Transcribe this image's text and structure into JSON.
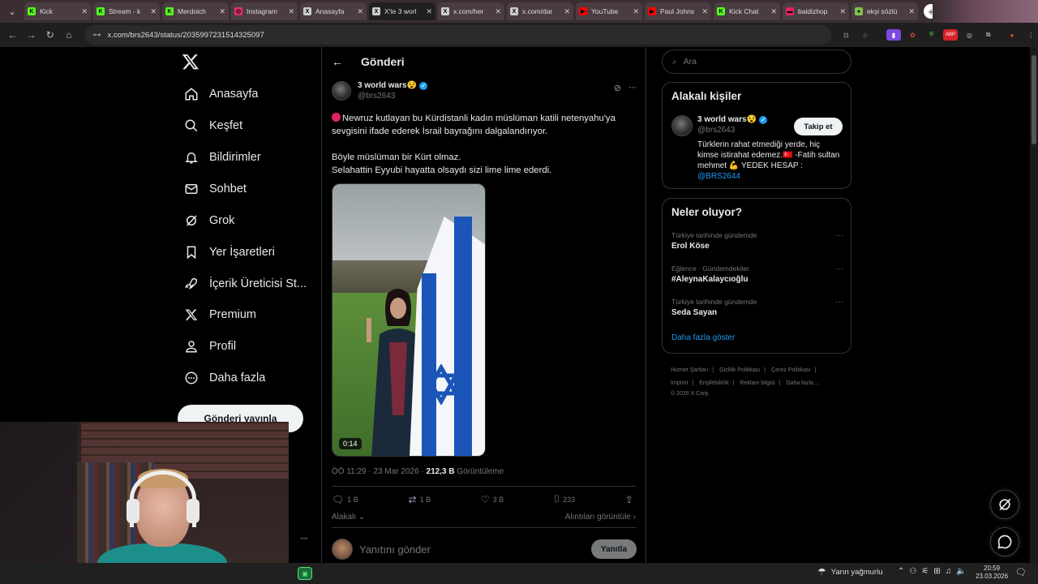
{
  "browser": {
    "tabs": [
      {
        "title": "Kick",
        "favicon_color": "#53fc18",
        "favicon": "K"
      },
      {
        "title": "Stream - k",
        "favicon_color": "#53fc18",
        "favicon": "K"
      },
      {
        "title": "Merdoich",
        "favicon_color": "#53fc18",
        "favicon": "K"
      },
      {
        "title": "Instagram",
        "favicon_color": "#e1306c",
        "favicon": "◎"
      },
      {
        "title": "Anasayfa",
        "favicon_color": "#cccccc",
        "favicon": "X"
      },
      {
        "title": "X'te 3 worl",
        "favicon_color": "#cccccc",
        "favicon": "X"
      },
      {
        "title": "x.com/her",
        "favicon_color": "#cccccc",
        "favicon": "X"
      },
      {
        "title": "x.com/dar",
        "favicon_color": "#cccccc",
        "favicon": "X"
      },
      {
        "title": "YouTube",
        "favicon_color": "#ff0000",
        "favicon": "▶"
      },
      {
        "title": "Paul Johns",
        "favicon_color": "#ff0000",
        "favicon": "▶"
      },
      {
        "title": "Kick Chat",
        "favicon_color": "#53fc18",
        "favicon": "K"
      },
      {
        "title": "baldizhop",
        "favicon_color": "#e0245e",
        "favicon": "▬"
      },
      {
        "title": "ekşi sözlü",
        "favicon_color": "#81c14b",
        "favicon": "●"
      }
    ],
    "url": "x.com/brs2643/status/2035997231514325097"
  },
  "nav": {
    "items": [
      {
        "label": "Anasayfa",
        "icon": "home-icon"
      },
      {
        "label": "Keşfet",
        "icon": "search-icon"
      },
      {
        "label": "Bildirimler",
        "icon": "bell-icon"
      },
      {
        "label": "Sohbet",
        "icon": "mail-icon"
      },
      {
        "label": "Grok",
        "icon": "grok-icon"
      },
      {
        "label": "Yer İşaretleri",
        "icon": "bookmark-icon"
      },
      {
        "label": "İçerik Üreticisi St...",
        "icon": "rocket-icon"
      },
      {
        "label": "Premium",
        "icon": "x-icon"
      },
      {
        "label": "Profil",
        "icon": "person-icon"
      },
      {
        "label": "Daha fazla",
        "icon": "more-circle-icon"
      }
    ],
    "post_button": "Gönderi yayınla"
  },
  "post": {
    "header_title": "Gönderi",
    "author_name": "3 world wars😵",
    "author_handle": "@brs2643",
    "text_line1": "Newruz kutlayan bu Kürdistanli kadın müslüman katili netenyahu'ya sevgisini ifade ederek İsrail bayrağını dalgalandırıyor.",
    "text_line2": "Böyle müslüman bir Kürt olmaz.",
    "text_line3": "Selahattin Eyyubi hayatta olsaydı sizi lime lime ederdi.",
    "video_duration": "0:14",
    "timestamp": "ÖÖ 11:29 · 23 Mar 2026 · ",
    "views_count": "212,3 B",
    "views_label": " Görüntüleme",
    "replies": "1 B",
    "reposts": "1 B",
    "likes": "3 B",
    "bookmarks": "233",
    "relevance_label": "Alakalı",
    "quotes_label": "Alıntıları görüntüle",
    "reply_placeholder": "Yanıtını gönder",
    "reply_button": "Yanıtla"
  },
  "right": {
    "search_placeholder": "Ara",
    "related_title": "Alakalı kişiler",
    "related_name": "3 world wars😵",
    "related_handle": "@brs2643",
    "follow_label": "Takip et",
    "bio_text": "Türklerin rahat etmediği yerde, hiç kimse istirahat edemez.🇹🇷 -Fatih sultan mehmet 💪 YEDEK HESAP : ",
    "bio_link": "@BRS2644",
    "trends_title": "Neler oluyor?",
    "trends": [
      {
        "context": "Türkiye tarihinde gündemde",
        "name": "Erol Köse"
      },
      {
        "context": "Eğlence · Gündemdekiler",
        "name": "#AleynaKalaycıoğlu"
      },
      {
        "context": "Türkiye tarihinde gündemde",
        "name": "Seda Sayan"
      }
    ],
    "show_more": "Daha fazla göster",
    "footer_links": [
      "Hizmet Şartları",
      "Gizlilik Politikası",
      "Çerez Politikası",
      "Imprint",
      "Erişilebilirlik",
      "Reklam bilgisi",
      "Daha fazla ..."
    ],
    "copyright": "© 2026 X Corp."
  },
  "taskbar": {
    "weather": "Yarın yağmurlu",
    "time": "20:59",
    "date": "23.03.2026"
  }
}
